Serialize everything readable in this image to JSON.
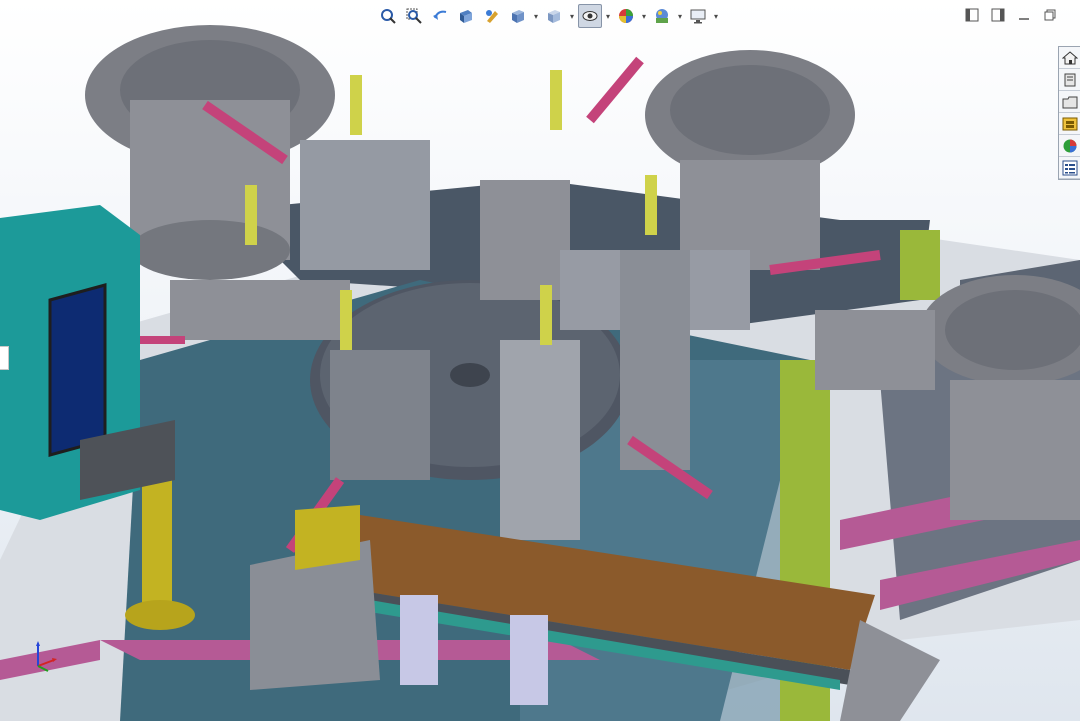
{
  "app": {
    "view_background": "#eef2f7"
  },
  "heads_up_toolbar": {
    "buttons": [
      {
        "name": "zoom-to-fit-icon"
      },
      {
        "name": "zoom-to-area-icon"
      },
      {
        "name": "previous-view-icon"
      },
      {
        "name": "section-view-icon"
      },
      {
        "name": "dynamic-annotation-icon"
      },
      {
        "name": "view-orientation-icon",
        "has_menu": true
      },
      {
        "name": "display-style-icon",
        "has_menu": true
      },
      {
        "name": "hide-show-items-icon",
        "has_menu": true,
        "active": true
      },
      {
        "name": "edit-appearance-icon",
        "has_menu": true
      },
      {
        "name": "apply-scene-icon",
        "has_menu": true
      },
      {
        "name": "view-settings-icon",
        "has_menu": true
      }
    ]
  },
  "window_controls": [
    "tile-left-icon",
    "tile-right-icon",
    "minimize-icon",
    "restore-icon"
  ],
  "task_pane_tabs": [
    "home-icon",
    "resources-icon",
    "design-library-icon",
    "file-explorer-icon",
    "view-palette-icon",
    "appearances-icon",
    "custom-properties-icon"
  ],
  "model": {
    "colors": {
      "frame_purple": "#b55a95",
      "frame_green": "#9ab83a",
      "table_blue": "#3f6a7c",
      "steel_grey": "#8e9097",
      "bowl_grey": "#7c7e85",
      "control_box_teal": "#1c9a99",
      "cylinder_pink": "#c4437a",
      "sensor_yellow": "#cfd24a",
      "pillar_yellow": "#c3b322",
      "conveyor_brown": "#8b5a2b",
      "belt_teal": "#2e9a8e"
    }
  },
  "triad": {
    "x_color": "#d22424",
    "y_color": "#1fa01f",
    "z_color": "#2545d8"
  }
}
